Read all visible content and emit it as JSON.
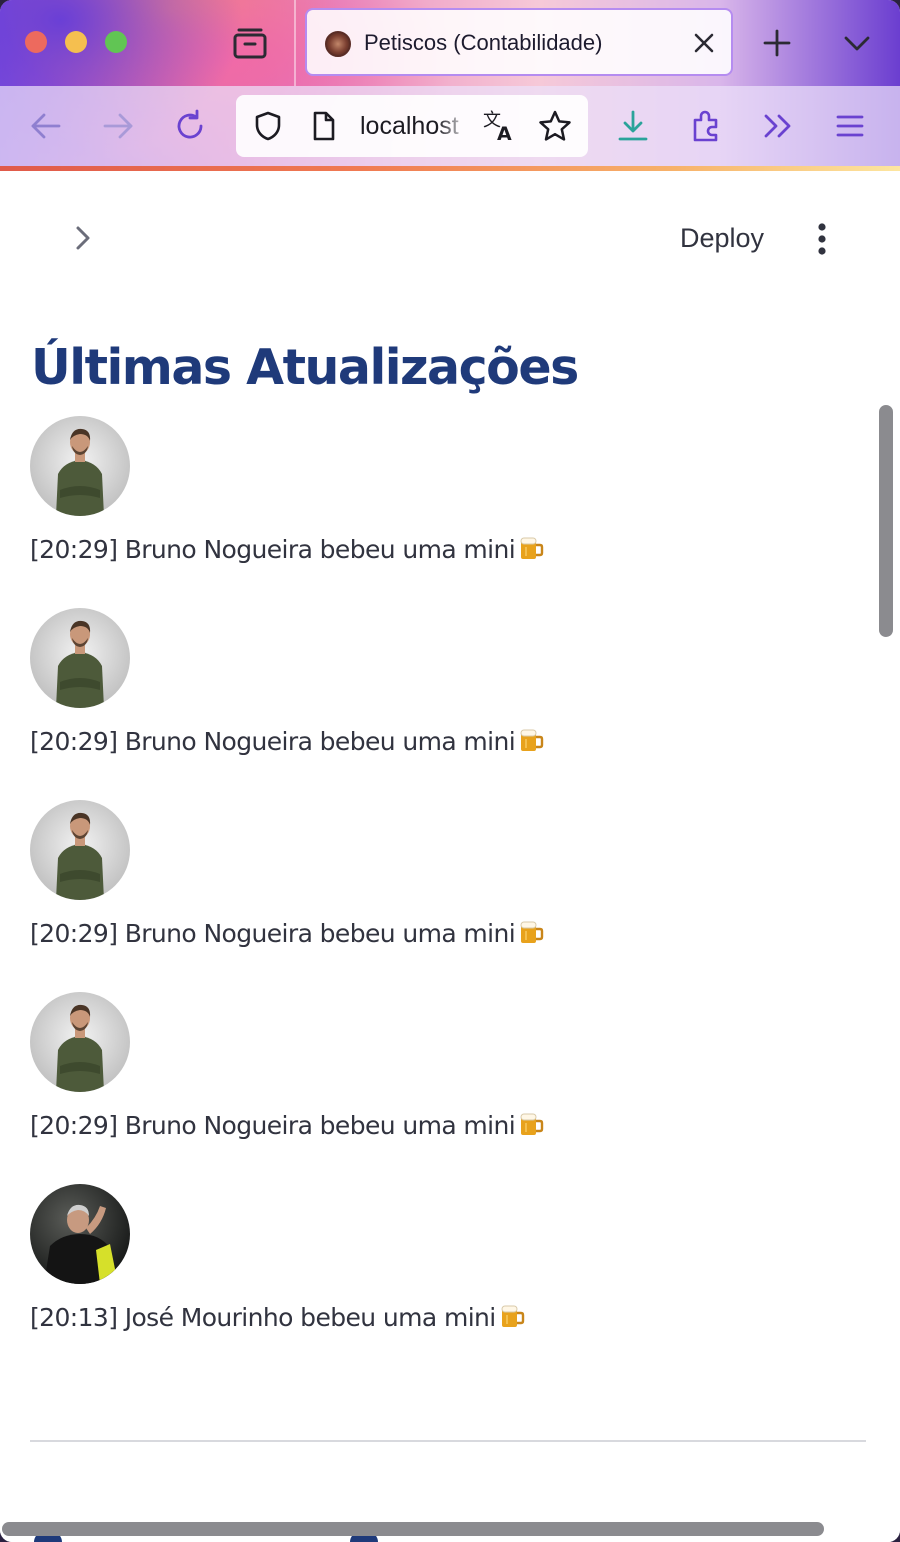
{
  "browser": {
    "tab": {
      "title": "Petiscos (Contabilidade)",
      "favicon": "petiscos-logo-icon"
    },
    "urlbar": {
      "url": "localhost"
    },
    "accent": "#7b4fd6"
  },
  "header": {
    "deploy_label": "Deploy"
  },
  "main": {
    "title": "Últimas Atualizações",
    "feed": [
      {
        "text": "[20:29] Bruno Nogueira bebeu uma mini",
        "emoji_icon": "beer-mug-icon",
        "avatar": "bruno"
      },
      {
        "text": "[20:29] Bruno Nogueira bebeu uma mini",
        "emoji_icon": "beer-mug-icon",
        "avatar": "bruno"
      },
      {
        "text": "[20:29] Bruno Nogueira bebeu uma mini",
        "emoji_icon": "beer-mug-icon",
        "avatar": "bruno"
      },
      {
        "text": "[20:29] Bruno Nogueira bebeu uma mini",
        "emoji_icon": "beer-mug-icon",
        "avatar": "bruno"
      },
      {
        "text": "[20:13] José Mourinho bebeu uma mini",
        "emoji_icon": "beer-mug-icon",
        "avatar": "jose"
      }
    ]
  },
  "colors": {
    "title": "#1f3a7a",
    "text": "#31333f"
  }
}
